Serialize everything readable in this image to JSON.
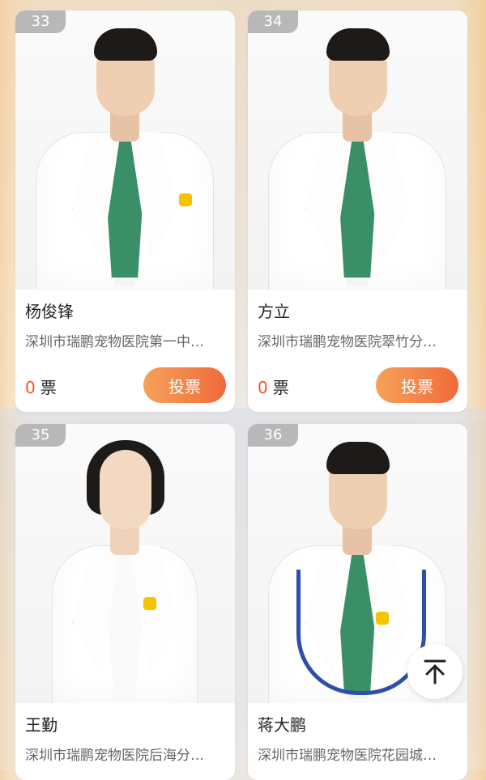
{
  "labels": {
    "vote_unit": "票",
    "vote_button": "投票"
  },
  "colors": {
    "accent": "#f06a3a",
    "vote_count": "#f0542c",
    "rank_badge": "#b8b8b8"
  },
  "icons": {
    "back_to_top": "arrow-up-to-line-icon"
  },
  "candidates": [
    {
      "rank": "33",
      "name": "杨俊锋",
      "hospital": "深圳市瑞鹏宠物医院第一中…",
      "votes": "0"
    },
    {
      "rank": "34",
      "name": "方立",
      "hospital": "深圳市瑞鹏宠物医院翠竹分…",
      "votes": "0"
    },
    {
      "rank": "35",
      "name": "王勤",
      "hospital": "深圳市瑞鹏宠物医院后海分…"
    },
    {
      "rank": "36",
      "name": "蒋大鹏",
      "hospital": "深圳市瑞鹏宠物医院花园城…"
    }
  ]
}
